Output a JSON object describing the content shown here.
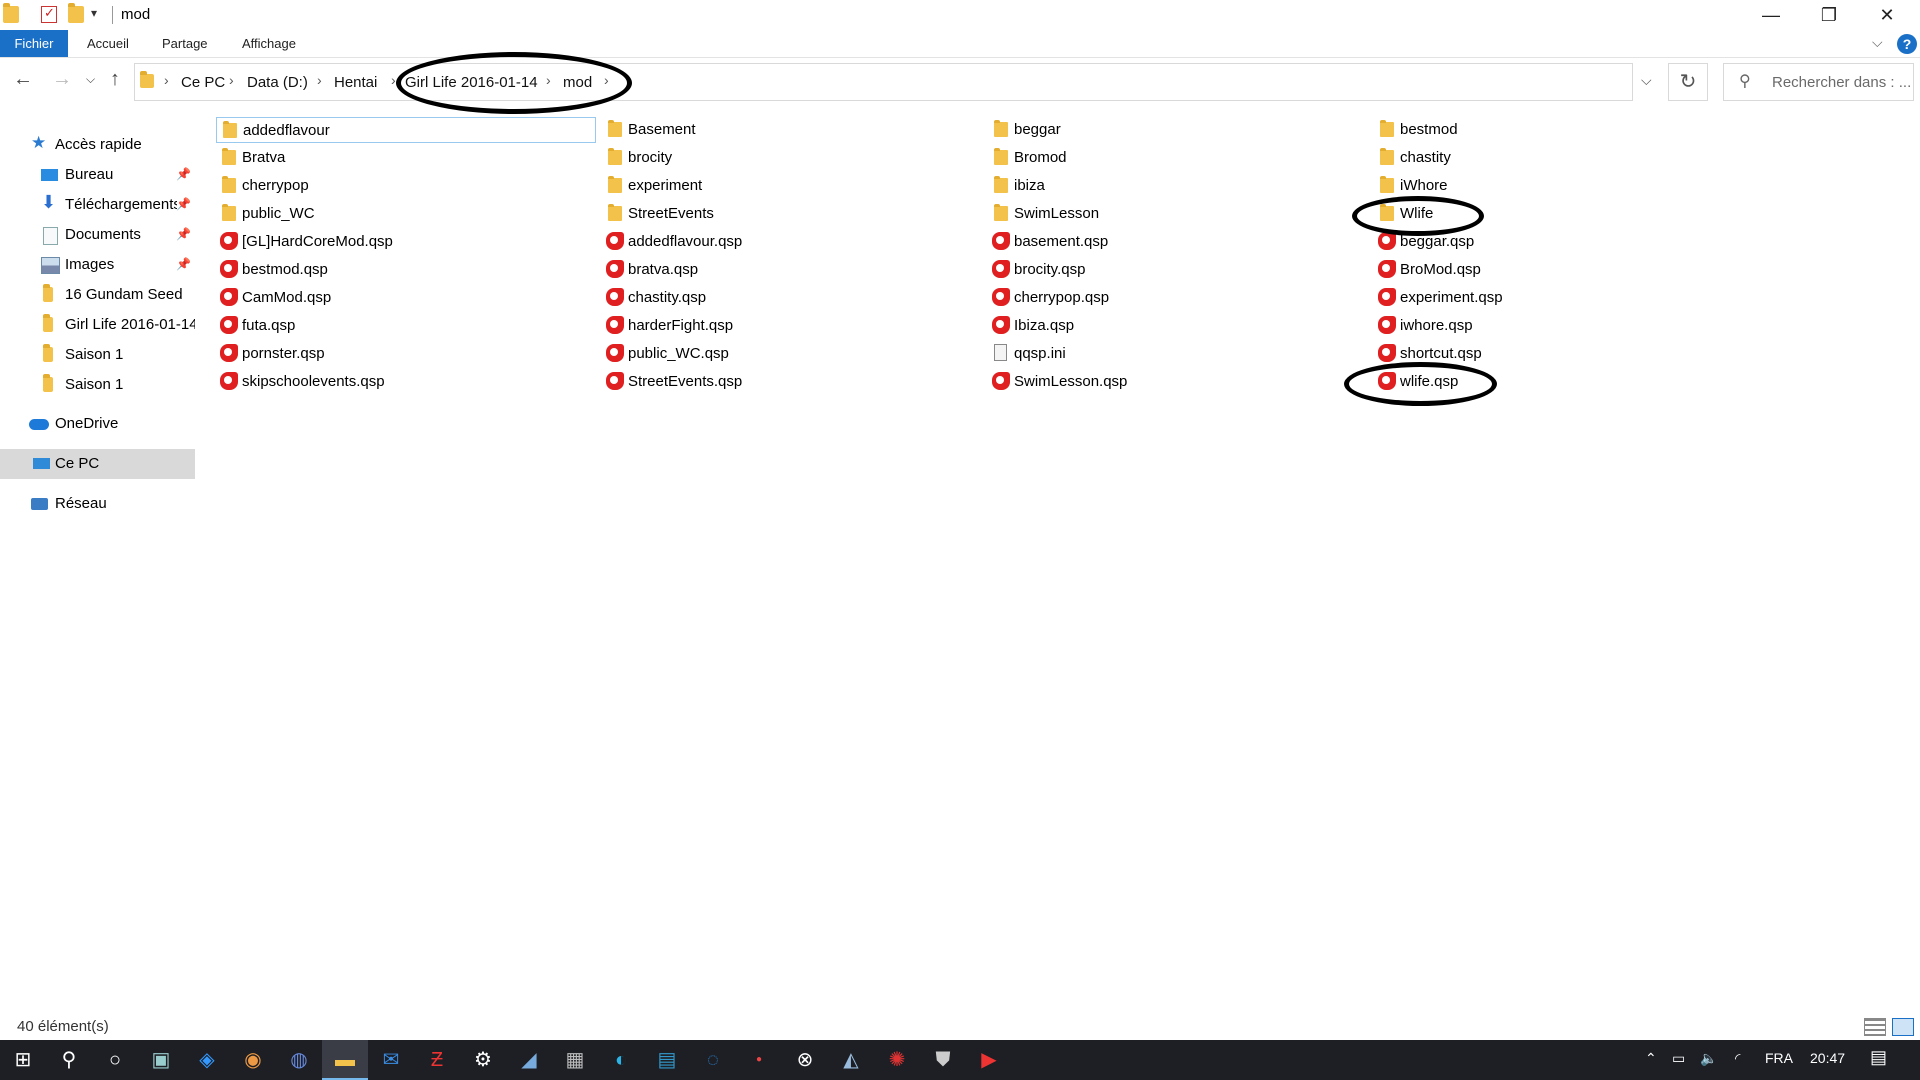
{
  "window": {
    "title": "mod",
    "controls": {
      "minimize": "—",
      "maximize": "❐",
      "close": "✕"
    }
  },
  "ribbon": {
    "tabs": [
      "Fichier",
      "Accueil",
      "Partage",
      "Affichage"
    ],
    "help": "?"
  },
  "address": {
    "crumbs": [
      "Ce PC",
      "Data (D:)",
      "Hentai",
      "Girl Life 2016-01-14",
      "mod"
    ],
    "search_placeholder": "Rechercher dans : ..."
  },
  "sidebar": {
    "quick_access": "Accès rapide",
    "quick_items": [
      "Bureau",
      "Téléchargements",
      "Documents",
      "Images",
      "16 Gundam Seed",
      "Girl Life 2016-01-14",
      "Saison 1",
      "Saison 1"
    ],
    "onedrive": "OneDrive",
    "this_pc": "Ce PC",
    "network": "Réseau"
  },
  "files": {
    "columns": [
      [
        {
          "name": "addedflavour",
          "type": "folder"
        },
        {
          "name": "Bratva",
          "type": "folder"
        },
        {
          "name": "cherrypop",
          "type": "folder"
        },
        {
          "name": "public_WC",
          "type": "folder"
        },
        {
          "name": "[GL]HardCoreMod.qsp",
          "type": "qsp"
        },
        {
          "name": "bestmod.qsp",
          "type": "qsp"
        },
        {
          "name": "CamMod.qsp",
          "type": "qsp"
        },
        {
          "name": "futa.qsp",
          "type": "qsp"
        },
        {
          "name": "pornster.qsp",
          "type": "qsp"
        },
        {
          "name": "skipschoolevents.qsp",
          "type": "qsp"
        }
      ],
      [
        {
          "name": "Basement",
          "type": "folder"
        },
        {
          "name": "brocity",
          "type": "folder"
        },
        {
          "name": "experiment",
          "type": "folder"
        },
        {
          "name": "StreetEvents",
          "type": "folder"
        },
        {
          "name": "addedflavour.qsp",
          "type": "qsp"
        },
        {
          "name": "bratva.qsp",
          "type": "qsp"
        },
        {
          "name": "chastity.qsp",
          "type": "qsp"
        },
        {
          "name": "harderFight.qsp",
          "type": "qsp"
        },
        {
          "name": "public_WC.qsp",
          "type": "qsp"
        },
        {
          "name": "StreetEvents.qsp",
          "type": "qsp"
        }
      ],
      [
        {
          "name": "beggar",
          "type": "folder"
        },
        {
          "name": "Bromod",
          "type": "folder"
        },
        {
          "name": "ibiza",
          "type": "folder"
        },
        {
          "name": "SwimLesson",
          "type": "folder"
        },
        {
          "name": "basement.qsp",
          "type": "qsp"
        },
        {
          "name": "brocity.qsp",
          "type": "qsp"
        },
        {
          "name": "cherrypop.qsp",
          "type": "qsp"
        },
        {
          "name": "Ibiza.qsp",
          "type": "qsp"
        },
        {
          "name": "qqsp.ini",
          "type": "ini"
        },
        {
          "name": "SwimLesson.qsp",
          "type": "qsp"
        }
      ],
      [
        {
          "name": "bestmod",
          "type": "folder"
        },
        {
          "name": "chastity",
          "type": "folder"
        },
        {
          "name": "iWhore",
          "type": "folder"
        },
        {
          "name": "Wlife",
          "type": "folder"
        },
        {
          "name": "beggar.qsp",
          "type": "qsp"
        },
        {
          "name": "BroMod.qsp",
          "type": "qsp"
        },
        {
          "name": "experiment.qsp",
          "type": "qsp"
        },
        {
          "name": "iwhore.qsp",
          "type": "qsp"
        },
        {
          "name": "shortcut.qsp",
          "type": "qsp"
        },
        {
          "name": "wlife.qsp",
          "type": "qsp"
        }
      ]
    ]
  },
  "status": {
    "count": "40 élément(s)"
  },
  "taskbar": {
    "icons": [
      "windows-start-icon",
      "search-icon",
      "cortana-icon",
      "task-view-icon",
      "app-icon",
      "chrome-icon",
      "app-icon",
      "file-explorer-icon",
      "mail-icon",
      "filezilla-icon",
      "settings-icon",
      "app-icon",
      "calculator-icon",
      "edge-icon",
      "app-icon",
      "app-icon",
      "app-icon",
      "app-icon",
      "app-icon",
      "app-icon",
      "app-icon",
      "app-icon"
    ],
    "tray": {
      "language": "FRA",
      "time": "20:47"
    }
  },
  "colors": {
    "accent": "#1a6fc7",
    "folder": "#f3c24a",
    "qsp": "#e02020",
    "taskbar": "#1d1f24"
  }
}
